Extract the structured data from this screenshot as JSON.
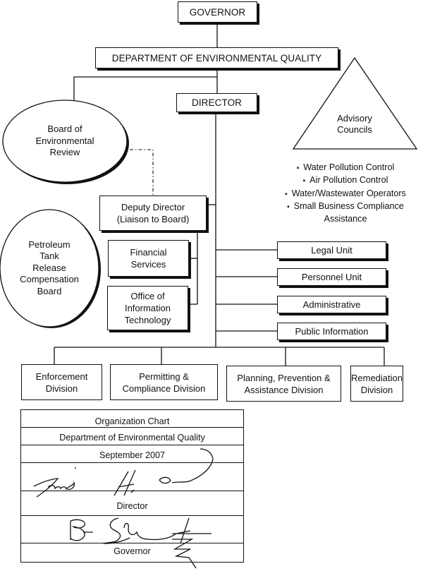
{
  "chart": {
    "top": {
      "governor": "GOVERNOR",
      "department": "DEPARTMENT OF ENVIRONMENTAL QUALITY",
      "director": "DIRECTOR"
    },
    "boards": {
      "environmental_review": "Board of\nEnvironmental\nReview",
      "petroleum": "Petroleum\nTank\nRelease\nCompensation\nBoard"
    },
    "advisory": {
      "title": "Advisory\nCouncils",
      "councils": [
        "Water Pollution Control",
        "Air Pollution Control",
        "Water/Wastewater Operators",
        "Small Business Compliance\nAssistance"
      ]
    },
    "deputy": {
      "deputy_director": "Deputy Director\n(Liaison to Board)",
      "financial_services": "Financial\nServices",
      "office_it": "Office of\nInformation\nTechnology"
    },
    "units": [
      "Legal Unit",
      "Personnel Unit",
      "Administrative",
      "Public Information"
    ],
    "divisions": [
      "Enforcement\nDivision",
      "Permitting &\nCompliance Division",
      "Planning, Prevention &\nAssistance Division",
      "Remediation\nDivision"
    ]
  },
  "signature_block": {
    "title": "Organization Chart",
    "department": "Department of Environmental Quality",
    "date": "September 2007",
    "director_label": "Director",
    "governor_label": "Governor"
  },
  "colors": {
    "ink": "#111111",
    "background": "#ffffff"
  }
}
